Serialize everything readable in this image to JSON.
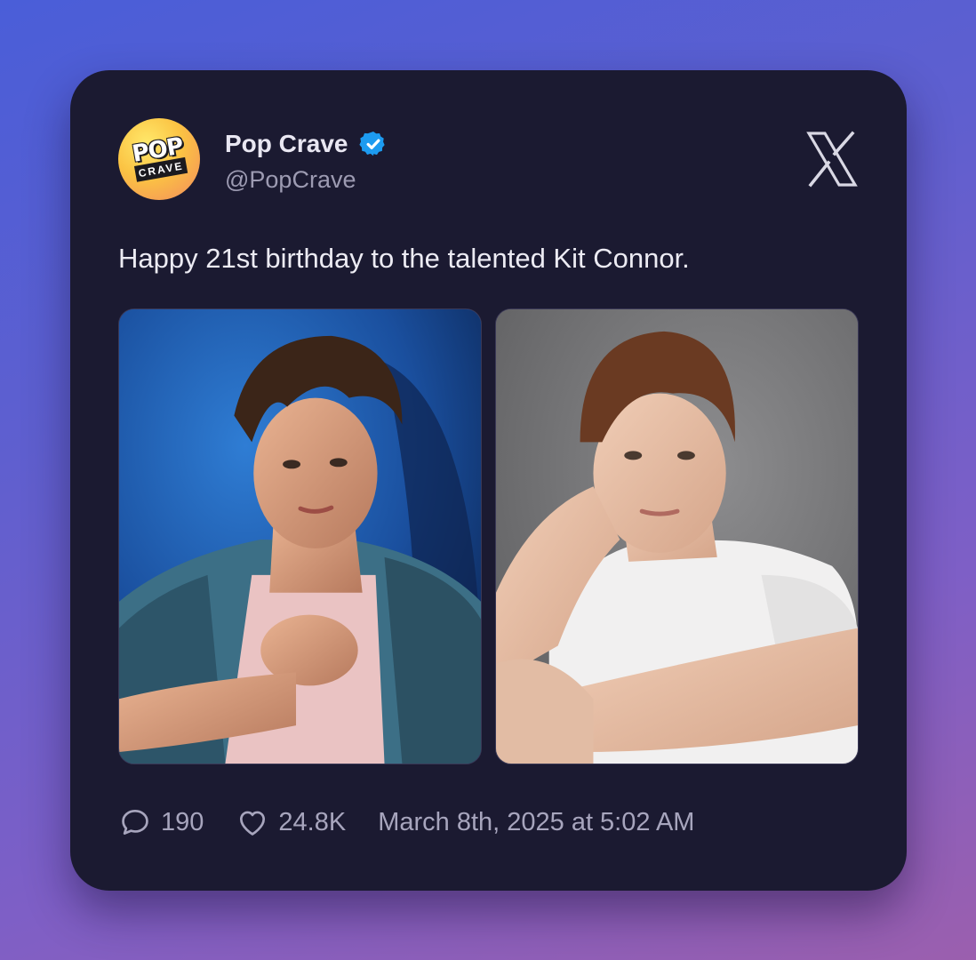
{
  "post": {
    "author": {
      "display_name": "Pop Crave",
      "handle": "@PopCrave",
      "verified": true,
      "avatar": {
        "logo_text_top": "POP",
        "logo_text_bottom": "CRAVE"
      }
    },
    "platform_icon": "x-logo-icon",
    "text": "Happy 21st birthday to the talented Kit Connor.",
    "media": [
      {
        "kind": "photo",
        "description_icon": "portrait-photo"
      },
      {
        "kind": "photo",
        "description_icon": "portrait-photo"
      }
    ],
    "stats": {
      "replies": "190",
      "likes": "24.8K"
    },
    "timestamp": "March 8th, 2025 at 5:02 AM"
  },
  "colors": {
    "card_background": "#1b1a31",
    "verified_badge": "#1d9bf0",
    "primary_text": "#ecebf3",
    "secondary_text": "#9d9bb2"
  }
}
